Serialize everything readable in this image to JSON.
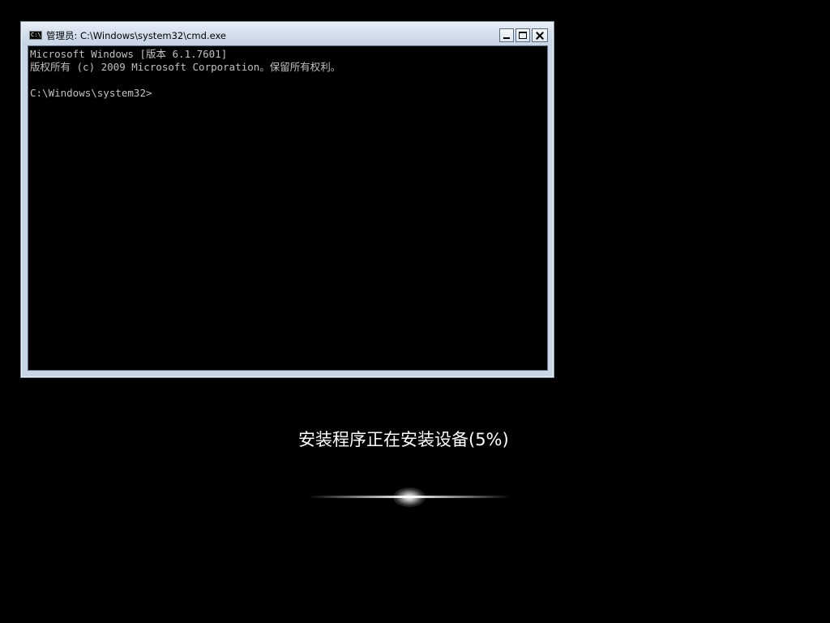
{
  "window": {
    "title": "管理员: C:\\Windows\\system32\\cmd.exe",
    "icon": "cmd-icon",
    "icon_text": "C:\\",
    "buttons": {
      "minimize": "minimize-icon",
      "maximize": "maximize-icon",
      "close": "close-icon"
    }
  },
  "console": {
    "lines": [
      "Microsoft Windows [版本 6.1.7601]",
      "版权所有 (c) 2009 Microsoft Corporation。保留所有权利。",
      "C:\\Windows\\system32>"
    ]
  },
  "setup": {
    "status": "安装程序正在安装设备(5%)",
    "progress_percent": 5
  },
  "colors": {
    "background": "#000000",
    "console_text": "#c0c0c0",
    "status_text": "#ffffff"
  }
}
